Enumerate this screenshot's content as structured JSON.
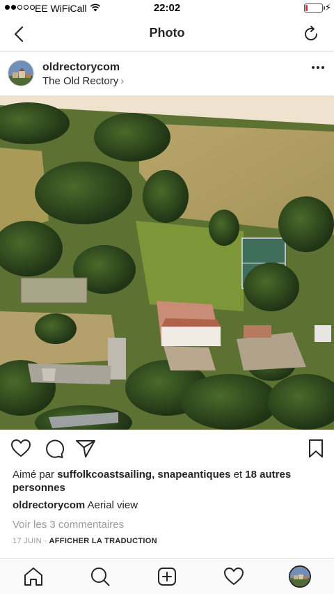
{
  "status_bar": {
    "carrier": "EE WiFiCall",
    "time": "22:02",
    "battery_level": 0.12,
    "signal_bars_on": 2,
    "signal_bars_total": 5,
    "icons": [
      "wifi-icon",
      "battery-icon",
      "charging-icon"
    ]
  },
  "nav": {
    "title": "Photo",
    "back_icon": "chevron-left-icon",
    "refresh_icon": "refresh-icon"
  },
  "post": {
    "username": "oldrectorycom",
    "location": "The Old Rectory",
    "location_chevron": "›",
    "photo_description_icon": "aerial-photo",
    "likes_prefix": "Aimé par ",
    "likes_names": "suffolkcoastsailing, snapeantiques",
    "likes_middle": " et ",
    "likes_others": "18 autres personnes",
    "caption_user": "oldrectorycom",
    "caption_text": " Aerial view",
    "view_comments": "Voir les 3 commentaires",
    "date": "17 JUIN",
    "separator": " · ",
    "translate": "AFFICHER LA TRADUCTION"
  },
  "actions": [
    "heart-icon",
    "comment-icon",
    "share-icon",
    "bookmark-icon"
  ],
  "tab_bar": [
    "home-icon",
    "search-icon",
    "add-post-icon",
    "activity-icon",
    "profile-avatar"
  ],
  "colors": {
    "text": "#262626",
    "muted": "#999999",
    "divider": "#dbdbdb",
    "battery_low": "#e0332f"
  }
}
